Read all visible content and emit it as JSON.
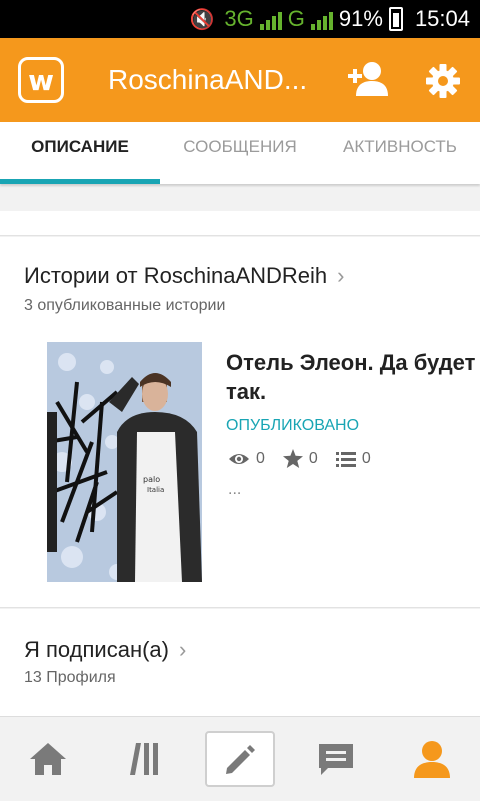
{
  "status_bar": {
    "network": "3G",
    "network_small": "3G",
    "network2": "G",
    "battery": "91%",
    "time": "15:04"
  },
  "app_bar": {
    "logo": "w",
    "title": "RoschinaAND..."
  },
  "tabs": [
    {
      "label": "ОПИСАНИЕ",
      "active": true
    },
    {
      "label": "СООБЩЕНИЯ",
      "active": false
    },
    {
      "label": "АКТИВНОСТЬ",
      "active": false
    }
  ],
  "stories": {
    "heading": "Истории от RoschinaANDReih",
    "subheading": "3 опубликованные истории",
    "items": [
      {
        "title_line1": "Отель Элеон. Да будет",
        "title_line2": "так.",
        "status": "ОПУБЛИКОВАНО",
        "views": "0",
        "votes": "0",
        "parts": "0",
        "excerpt": "..."
      }
    ]
  },
  "following": {
    "heading": "Я подписан(а)",
    "subheading": "13 Профиля"
  },
  "bottom_nav": [
    "home-icon",
    "library-icon",
    "write-icon",
    "messages-icon",
    "profile-icon"
  ],
  "colors": {
    "accent": "#f5981c",
    "teal": "#19a5b4",
    "active_nav": "#f5981c",
    "inactive_nav": "#7a7a7a"
  }
}
